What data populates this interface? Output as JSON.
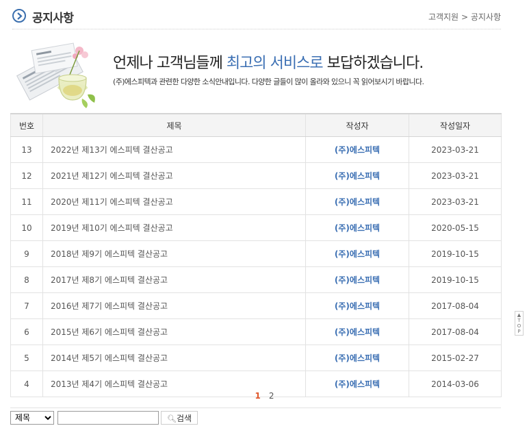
{
  "header": {
    "title": "공지사항",
    "breadcrumb": {
      "parent": "고객지원",
      "separator": ">",
      "current": "공지사항"
    }
  },
  "banner": {
    "heading_pre": "언제나 고객님들께 ",
    "heading_highlight": "최고의 서비스로",
    "heading_post": " 보답하겠습니다.",
    "subtext": "(주)에스피텍과 관련한 다양한 소식안내입니다. 다양한 글들이 많이 올라와 있으니 꼭 읽어보시기 바랍니다."
  },
  "table": {
    "headers": {
      "no": "번호",
      "subject": "제목",
      "author": "작성자",
      "date": "작성일자"
    },
    "rows": [
      {
        "no": "13",
        "subject": "2022년 제13기 에스피텍 결산공고",
        "author": "(주)에스피텍",
        "date": "2023-03-21"
      },
      {
        "no": "12",
        "subject": "2021년 제12기 에스피텍 결산공고",
        "author": "(주)에스피텍",
        "date": "2023-03-21"
      },
      {
        "no": "11",
        "subject": "2020년 제11기 에스피텍 결산공고",
        "author": "(주)에스피텍",
        "date": "2023-03-21"
      },
      {
        "no": "10",
        "subject": "2019년 제10기 에스피텍 결산공고",
        "author": "(주)에스피텍",
        "date": "2020-05-15"
      },
      {
        "no": "9",
        "subject": "2018년 제9기 에스피텍 결산공고",
        "author": "(주)에스피텍",
        "date": "2019-10-15"
      },
      {
        "no": "8",
        "subject": "2017년 제8기 에스피텍 결산공고",
        "author": "(주)에스피텍",
        "date": "2019-10-15"
      },
      {
        "no": "7",
        "subject": "2016년 제7기 에스피텍 결산공고",
        "author": "(주)에스피텍",
        "date": "2017-08-04"
      },
      {
        "no": "6",
        "subject": "2015년 제6기 에스피텍 결산공고",
        "author": "(주)에스피텍",
        "date": "2017-08-04"
      },
      {
        "no": "5",
        "subject": "2014년 제5기 에스피텍 결산공고",
        "author": "(주)에스피텍",
        "date": "2015-02-27"
      },
      {
        "no": "4",
        "subject": "2013년 제4기 에스피텍 결산공고",
        "author": "(주)에스피텍",
        "date": "2014-03-06"
      }
    ]
  },
  "pagination": {
    "current": "1",
    "pages": [
      "2"
    ]
  },
  "search": {
    "field_selected": "제목",
    "field_options": [
      "제목"
    ],
    "query": "",
    "button_label": "검색"
  },
  "top_button": {
    "label": "TOP"
  },
  "colors": {
    "accent_blue": "#3b6fb3",
    "active_page": "#e0572a"
  }
}
